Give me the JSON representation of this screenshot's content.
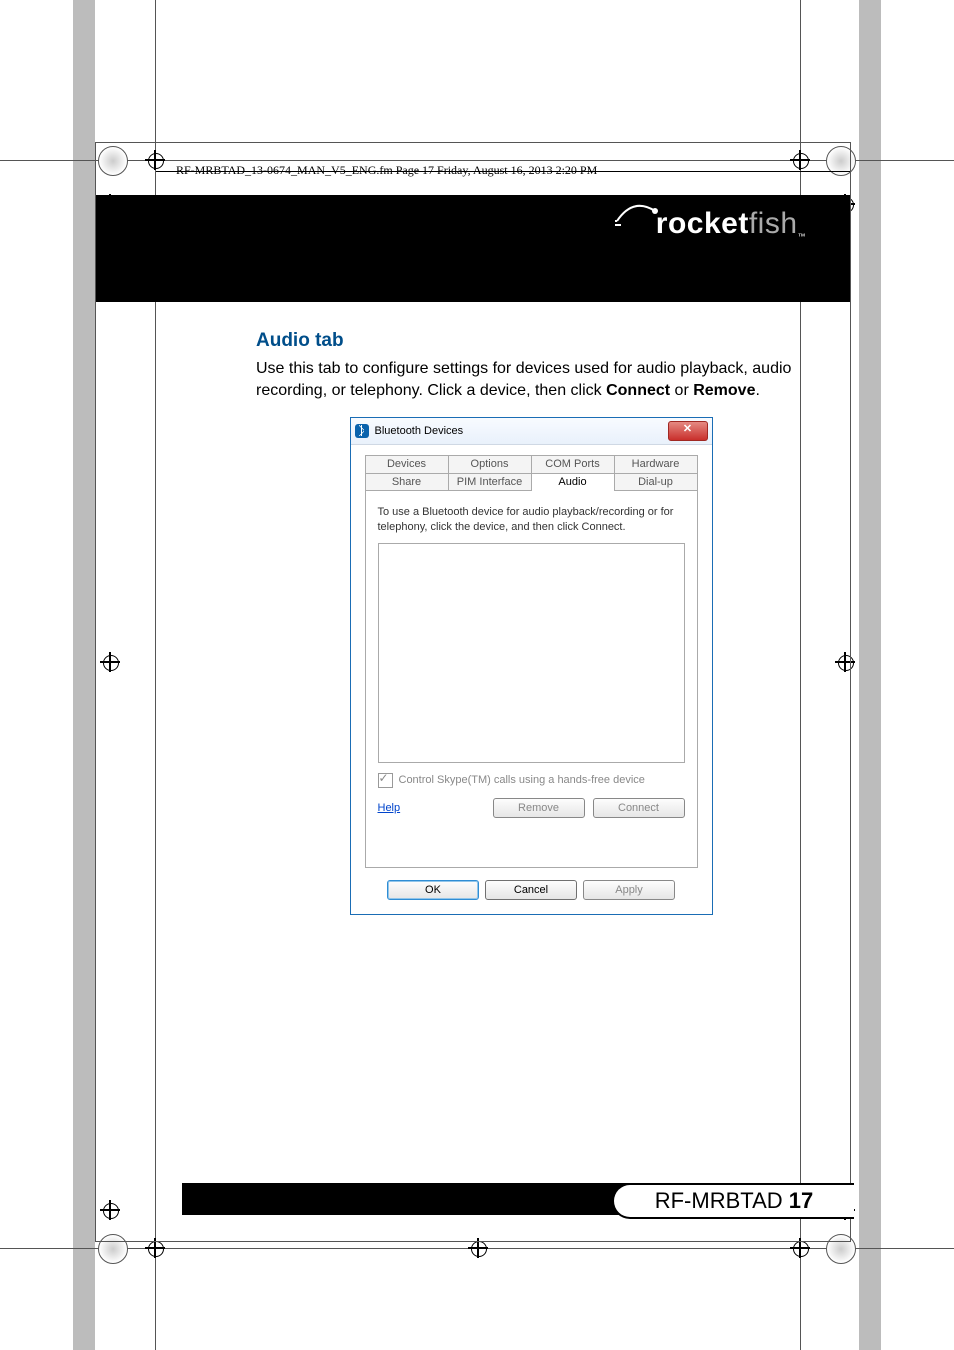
{
  "crop_header": "RF-MRBTAD_13-0674_MAN_V5_ENG.fm  Page 17  Friday, August 16, 2013  2:20 PM",
  "brand": {
    "name_bold": "rocket",
    "name_light": "fish",
    "tm": "™"
  },
  "section": {
    "heading": "Audio tab",
    "para_1": "Use this tab to configure settings for devices used for audio playback, audio recording, or telephony. Click a device, then click ",
    "bold_1": "Connect",
    "para_or": " or ",
    "bold_2": "Remove",
    "para_end": "."
  },
  "dialog": {
    "title": "Bluetooth Devices",
    "close": "✕",
    "tabs_row1": [
      "Devices",
      "Options",
      "COM Ports",
      "Hardware"
    ],
    "tabs_row2": [
      "Share",
      "PIM Interface",
      "Audio",
      "Dial-up"
    ],
    "active_tab": "Audio",
    "instruction": "To use a Bluetooth device for audio playback/recording or for telephony, click the device, and then click Connect.",
    "checkbox_label": "Control Skype(TM) calls using a hands-free device",
    "help": "Help",
    "remove": "Remove",
    "connect": "Connect",
    "ok": "OK",
    "cancel": "Cancel",
    "apply": "Apply"
  },
  "footer": {
    "model": "RF-MRBTAD",
    "page": "17"
  }
}
